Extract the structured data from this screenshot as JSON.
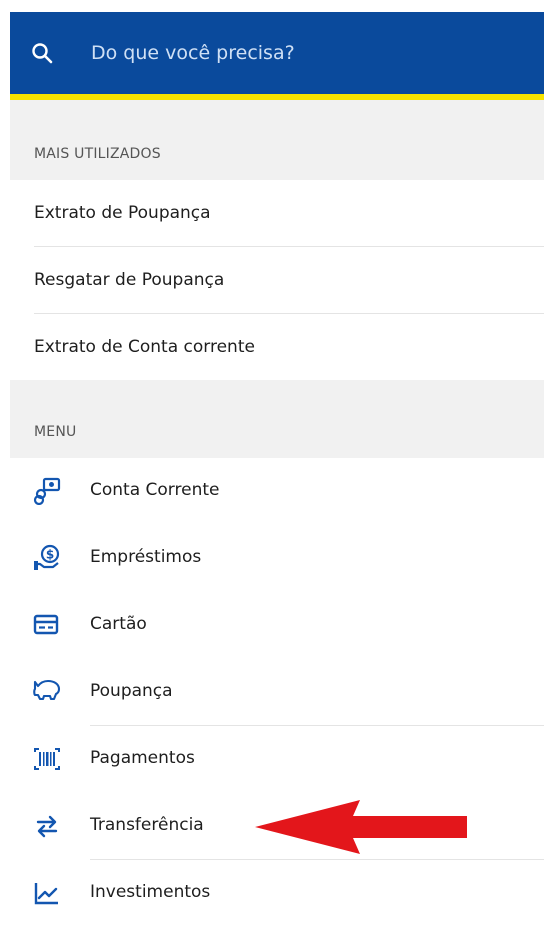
{
  "search": {
    "placeholder": "Do que você precisa?"
  },
  "sections": {
    "most_used": "MAIS UTILIZADOS",
    "menu": "MENU"
  },
  "most_used_items": [
    {
      "label": "Extrato de Poupança"
    },
    {
      "label": "Resgatar de Poupança"
    },
    {
      "label": "Extrato de Conta corrente"
    }
  ],
  "menu_items": [
    {
      "label": "Conta Corrente",
      "icon": "current-account-icon"
    },
    {
      "label": "Empréstimos",
      "icon": "loan-icon"
    },
    {
      "label": "Cartão",
      "icon": "card-icon"
    },
    {
      "label": "Poupança",
      "icon": "piggy-bank-icon"
    },
    {
      "label": "Pagamentos",
      "icon": "barcode-icon"
    },
    {
      "label": "Transferência",
      "icon": "transfer-icon"
    },
    {
      "label": "Investimentos",
      "icon": "investments-icon"
    }
  ],
  "colors": {
    "header": "#0a4a9c",
    "accent_yellow": "#f7e300",
    "icon_blue": "#1356b0",
    "annotation_arrow": "#e3161b"
  }
}
